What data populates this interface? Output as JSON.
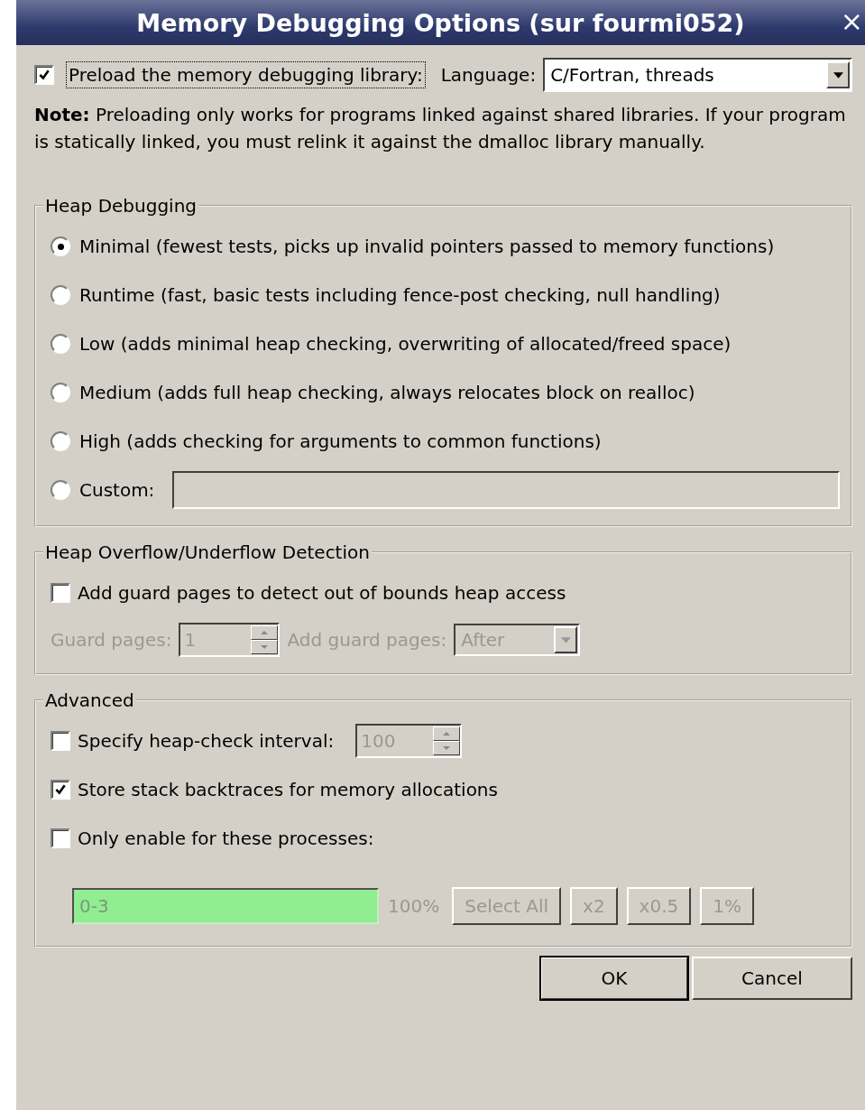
{
  "window": {
    "title": "Memory Debugging Options (sur fourmi052)",
    "close": "×"
  },
  "preload": {
    "label": "Preload the memory debugging library:",
    "checked": true,
    "focused": true
  },
  "language": {
    "label": "Language:",
    "value": "C/Fortran, threads"
  },
  "note": "**Note:** Preloading only works for programs linked against shared libraries. If your program is statically linked, you must relink it against the dmalloc library manually.",
  "heap_debugging": {
    "title": "Heap Debugging",
    "options": [
      {
        "label": "Minimal (fewest tests, picks up invalid pointers passed to memory functions)",
        "selected": true
      },
      {
        "label": "Runtime (fast, basic tests including fence-post checking, null handling)",
        "selected": false
      },
      {
        "label": "Low (adds minimal heap checking, overwriting of allocated/freed space)",
        "selected": false
      },
      {
        "label": "Medium (adds full heap checking, always relocates block on realloc)",
        "selected": false
      },
      {
        "label": "High (adds checking for arguments to common functions)",
        "selected": false
      },
      {
        "label": "Custom:",
        "selected": false,
        "kind": "field"
      }
    ]
  },
  "overflow": {
    "title": "Heap Overflow/Underflow Detection",
    "guard": {
      "label": "Add guard pages to detect out of bounds heap access",
      "checked": false
    },
    "guard_pages": {
      "label": "Guard pages:",
      "value": "1",
      "disabled": true
    },
    "placement": {
      "label": "Add guard pages:",
      "value": "After",
      "disabled": true
    }
  },
  "advanced": {
    "title": "Advanced",
    "interval": {
      "label": "Specify heap-check interval:",
      "checked": false,
      "value": "100",
      "disabled": true
    },
    "backtraces": {
      "label": "Store stack backtraces for memory allocations",
      "checked": true
    },
    "processes": {
      "label": "Only enable for these processes:",
      "checked": false,
      "value": "0-3",
      "percent": "100%",
      "disabled": true,
      "buttons": [
        "Select All",
        "x2",
        "x0.5",
        "1%"
      ]
    }
  },
  "buttons": [
    "OK",
    "Cancel"
  ]
}
